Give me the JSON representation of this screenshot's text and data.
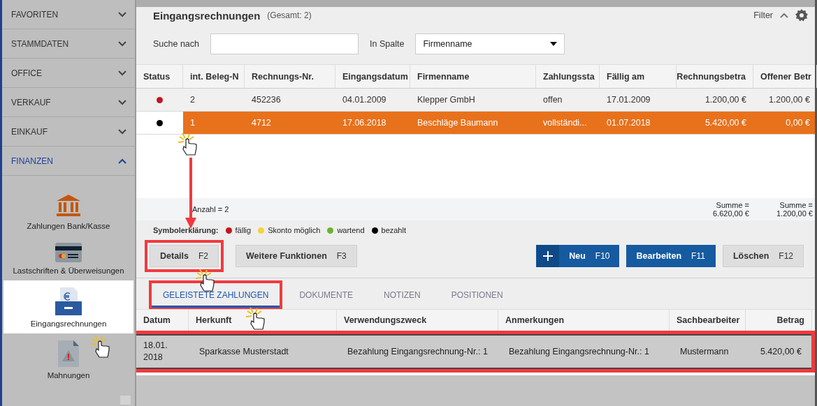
{
  "sidebar": {
    "sections": [
      {
        "label": "FAVORITEN",
        "expanded": false
      },
      {
        "label": "STAMMDATEN",
        "expanded": false
      },
      {
        "label": "OFFICE",
        "expanded": false
      },
      {
        "label": "VERKAUF",
        "expanded": false
      },
      {
        "label": "EINKAUF",
        "expanded": false
      },
      {
        "label": "FINANZEN",
        "expanded": true
      }
    ],
    "items": [
      {
        "label": "Zahlungen Bank/Kasse",
        "kind": "bank",
        "selected": false
      },
      {
        "label": "Lastschriften & Überweisungen",
        "kind": "card",
        "selected": false
      },
      {
        "label": "Eingangsrechnungen",
        "kind": "invoice",
        "selected": true
      },
      {
        "label": "Mahnungen",
        "kind": "reminder",
        "selected": false
      }
    ]
  },
  "header": {
    "title": "Eingangsrechnungen",
    "count": "(Gesamt: 2)",
    "filter": "Filter"
  },
  "search": {
    "label": "Suche nach",
    "column_label": "In Spalte",
    "column_value": "Firmenname"
  },
  "table": {
    "columns": [
      "Status",
      "int. Beleg-N",
      "Rechnungs-Nr.",
      "Eingangsdatum",
      "Firmenname",
      "Zahlungssta",
      "Fällig am",
      "Rechnungsbetra",
      "Offener Betr"
    ],
    "rows": [
      {
        "color": "#c0161f",
        "selected": false,
        "cells": [
          "",
          "2",
          "452236",
          "04.01.2009",
          "Klepper GmbH",
          "offen",
          "17.01.2009",
          "1.200,00 €",
          "1.200,00 €"
        ]
      },
      {
        "color": "#000000",
        "selected": true,
        "cells": [
          "",
          "1",
          "4712",
          "17.06.2018",
          "Beschläge Baumann",
          "vollständi...",
          "01.07.2018",
          "5.420,00 €",
          "0,00 €"
        ]
      }
    ],
    "footer": {
      "count": "Anzahl = 2",
      "sums": [
        "Summe = 6.620,00 €",
        "Summe = 1.200,00 €"
      ]
    }
  },
  "legend": {
    "label": "Symbolerklärung:",
    "items": [
      {
        "label": "fällig",
        "color": "#c0161f"
      },
      {
        "label": "Skonto möglich",
        "color": "#f5d33a"
      },
      {
        "label": "wartend",
        "color": "#6ab42d"
      },
      {
        "label": "bezahlt",
        "color": "#000000"
      }
    ]
  },
  "actions_left": [
    {
      "label": "Details",
      "key": "F2",
      "kind": "plain",
      "highlighted": true
    },
    {
      "label": "Weitere Funktionen",
      "key": "F3",
      "kind": "plain",
      "highlighted": false
    }
  ],
  "actions_right": [
    {
      "label": "Neu",
      "key": "F10",
      "kind": "add"
    },
    {
      "label": "Bearbeiten",
      "key": "F11",
      "kind": "primary"
    },
    {
      "label": "Löschen",
      "key": "F12",
      "kind": "plain"
    }
  ],
  "tabs": [
    {
      "label": "GELEISTETE ZAHLUNGEN",
      "selected": true,
      "highlighted": true
    },
    {
      "label": "DOKUMENTE",
      "selected": false,
      "highlighted": false
    },
    {
      "label": "NOTIZEN",
      "selected": false,
      "highlighted": false
    },
    {
      "label": "POSITIONEN",
      "selected": false,
      "highlighted": false
    }
  ],
  "payments": {
    "columns": [
      "Datum",
      "Herkunft",
      "Verwendungszweck",
      "Anmerkungen",
      "Sachbearbeiter",
      "Betrag"
    ],
    "rows": [
      {
        "highlighted": true,
        "cells": [
          "18.01. 2018",
          "Sparkasse Musterstadt",
          "Bezahlung Eingangsrechnung-Nr.: 1",
          "Bezahlung Eingangsrechnung-Nr.: 1",
          "Mustermann",
          "5.420,00 €"
        ]
      }
    ]
  }
}
